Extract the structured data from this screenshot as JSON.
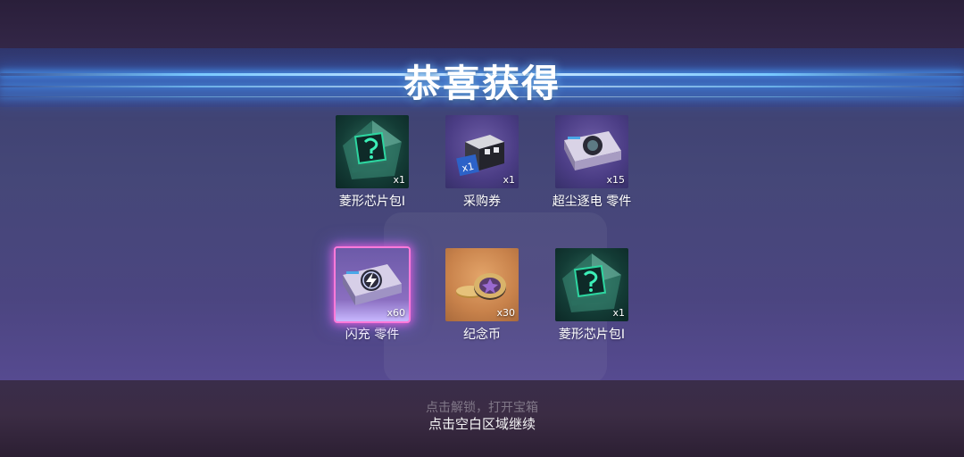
{
  "title": "恭喜获得",
  "rewards": [
    {
      "name": "菱形芯片包I",
      "qty": "x1",
      "icon": "diamond-chip-pack-icon"
    },
    {
      "name": "采购券",
      "qty": "x1",
      "icon": "purchase-voucher-icon"
    },
    {
      "name": "超尘逐电 零件",
      "qty": "x15",
      "icon": "part-card-icon"
    },
    {
      "name": "闪充 零件",
      "qty": "x60",
      "icon": "flash-charge-part-icon"
    },
    {
      "name": "纪念币",
      "qty": "x30",
      "icon": "commemorative-coin-icon"
    },
    {
      "name": "菱形芯片包I",
      "qty": "x1",
      "icon": "diamond-chip-pack-icon"
    }
  ],
  "hints": {
    "faint": "点击解锁，打开宝箱",
    "main": "点击空白区域继续"
  },
  "colors": {
    "highlight_glow": "#ff7ad9",
    "beam": "#7fd0ff",
    "chip_green": "#2dd6a0"
  }
}
